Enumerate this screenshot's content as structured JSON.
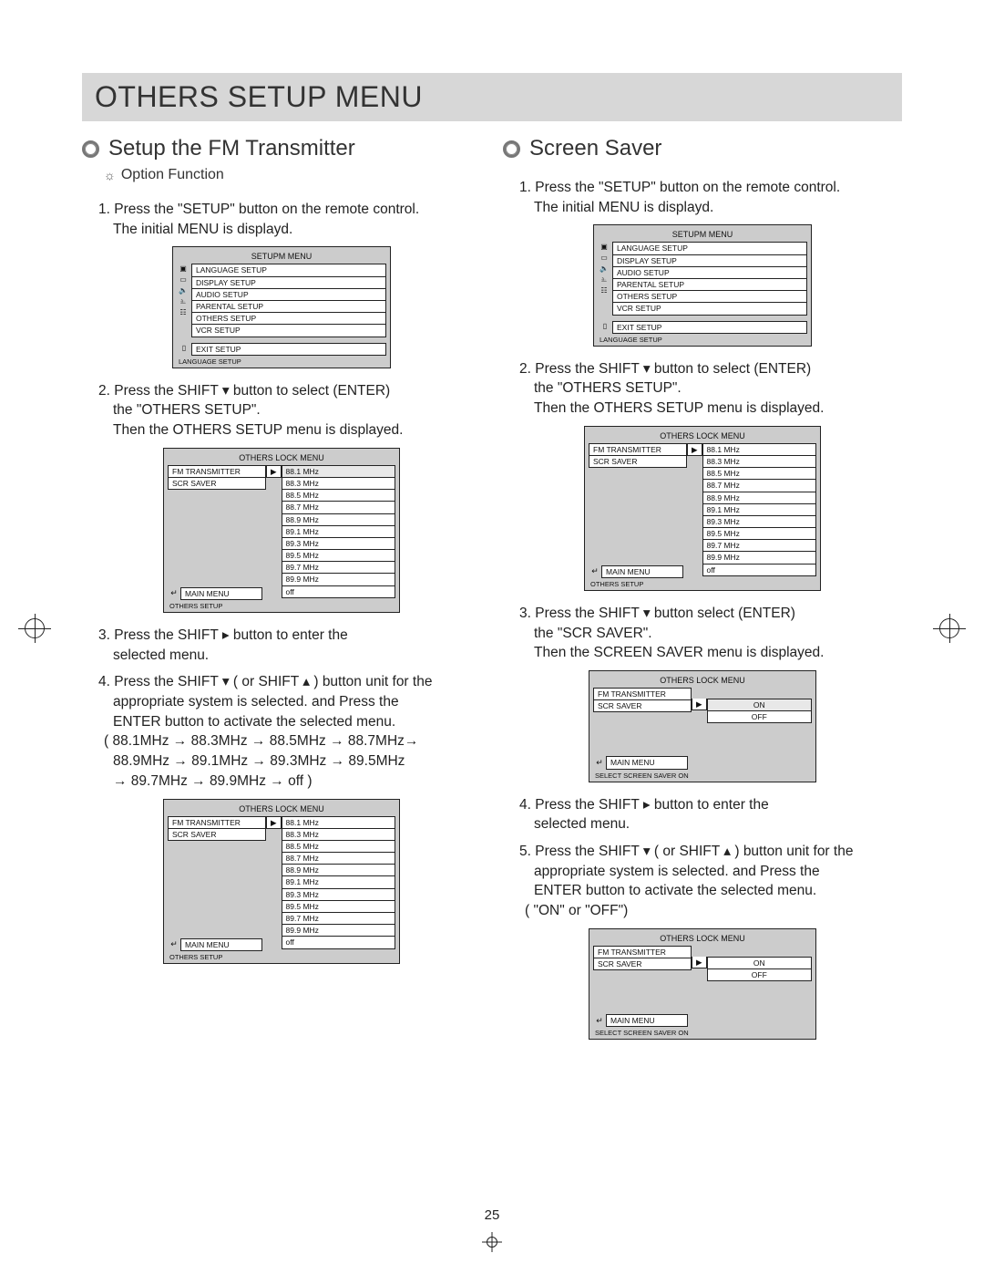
{
  "page_number": "25",
  "title": "OTHERS SETUP MENU",
  "left": {
    "heading": "Setup the FM Transmitter",
    "option_label": "Option Function",
    "steps": {
      "s1a": "1. Press the \"SETUP\" button on the remote control.",
      "s1b": "The initial MENU is displayd.",
      "s2a": "2. Press the SHIFT ▾ button to select (ENTER)",
      "s2b": "the \"OTHERS SETUP\".",
      "s2c": "Then the OTHERS SETUP menu is displayed.",
      "s3a": "3. Press the SHIFT ▸ button to enter the",
      "s3b": "selected menu.",
      "s4a": "4. Press the SHIFT ▾ ( or SHIFT ▴ ) button unit for the",
      "s4b": "appropriate system is selected. and Press the",
      "s4c": "ENTER button to activate the selected menu.",
      "s4d": "( 88.1MHz → 88.3MHz → 88.5MHz → 88.7MHz→",
      "s4e": "88.9MHz → 89.1MHz → 89.3MHz → 89.5MHz",
      "s4f": "→ 89.7MHz → 89.9MHz → off )"
    }
  },
  "right": {
    "heading": "Screen Saver",
    "steps": {
      "s1a": "1. Press the \"SETUP\" button on the remote control.",
      "s1b": "The initial MENU is displayd.",
      "s2a": "2. Press the SHIFT ▾ button to select (ENTER)",
      "s2b": "the \"OTHERS SETUP\".",
      "s2c": "Then the OTHERS SETUP menu is displayed.",
      "s3a": "3. Press the SHIFT ▾ button select (ENTER)",
      "s3b": "the \"SCR SAVER\".",
      "s3c": "Then the SCREEN SAVER menu is displayed.",
      "s4a": "4. Press the SHIFT ▸ button to enter the",
      "s4b": "selected menu.",
      "s5a": "5. Press the SHIFT ▾ ( or SHIFT ▴ ) button unit for the",
      "s5b": "appropriate system is selected. and Press the",
      "s5c": "ENTER button to activate the selected menu.",
      "s5d": "( \"ON\"  or \"OFF\")"
    }
  },
  "osd": {
    "setup_menu": {
      "title": "SETUPM MENU",
      "items": [
        "LANGUAGE SETUP",
        "DISPLAY SETUP",
        "AUDIO SETUP",
        "PARENTAL SETUP",
        "OTHERS SETUP",
        "VCR SETUP"
      ],
      "exit": "EXIT SETUP",
      "footer": "LANGUAGE SETUP"
    },
    "others_menu": {
      "title": "OTHERS LOCK MENU",
      "left_items": [
        "FM TRANSMITTER",
        "SCR SAVER"
      ],
      "main_menu": "MAIN MENU",
      "footer": "OTHERS SETUP",
      "freqs": [
        "88.1 MHz",
        "88.3 MHz",
        "88.5 MHz",
        "88.7 MHz",
        "88.9 MHz",
        "89.1 MHz",
        "89.3 MHz",
        "89.5 MHz",
        "89.7 MHz",
        "89.9 MHz",
        "off"
      ]
    },
    "saver_menu": {
      "title": "OTHERS LOCK MENU",
      "left_items": [
        "FM TRANSMITTER",
        "SCR SAVER"
      ],
      "options": [
        "ON",
        "OFF"
      ],
      "main_menu": "MAIN MENU",
      "footer": "SELECT SCREEN SAVER ON"
    }
  }
}
